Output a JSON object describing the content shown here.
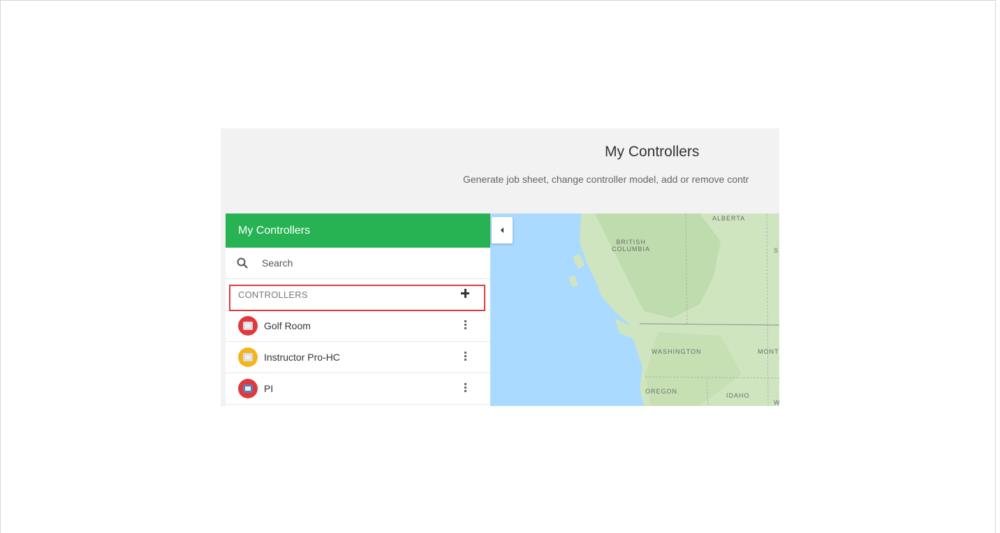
{
  "page": {
    "title": "My Controllers",
    "subtitle": "Generate job sheet, change controller model, add or remove contr"
  },
  "panel": {
    "header": "My Controllers",
    "search_placeholder": "Search",
    "section_label": "CONTROLLERS",
    "items": [
      {
        "label": "Golf Room",
        "avatar_color": "#e0393b"
      },
      {
        "label": "Instructor Pro-HC",
        "avatar_color": "#f5b41a"
      },
      {
        "label": "PI",
        "avatar_color": "#e0393b"
      }
    ]
  },
  "map": {
    "labels": [
      "ALBERTA",
      "BRITISH\nCOLUMBIA",
      "S",
      "WASHINGTON",
      "MONT",
      "OREGON",
      "IDAHO",
      "W"
    ]
  },
  "colors": {
    "accent": "#27b353",
    "highlight": "#e0393b",
    "water": "#aadaff",
    "land": "#cfe5c0"
  }
}
